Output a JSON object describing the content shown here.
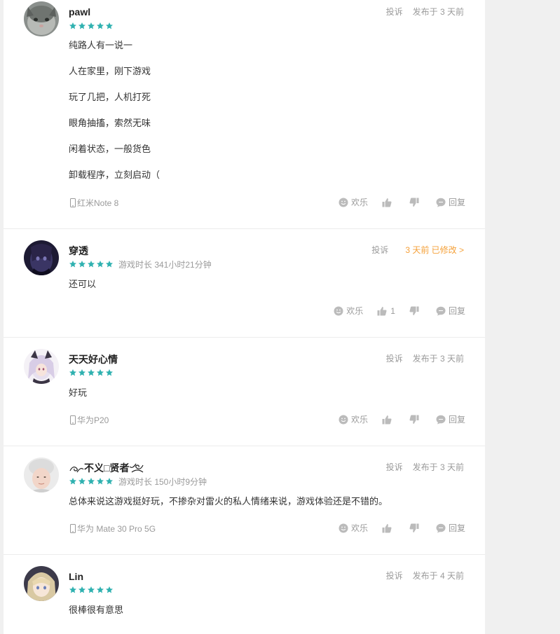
{
  "report_label": "投诉",
  "actions": {
    "fun_label": "欢乐",
    "reply_label": "回复"
  },
  "colors": {
    "star": "#2fb1b0",
    "edited_date": "#f5a13a",
    "muted": "#9a9a9a"
  },
  "reviews": [
    {
      "name": "pawl",
      "rating": 5,
      "playtime": "",
      "date": "发布于 3 天前",
      "content": [
        "纯路人有一说一",
        "人在家里，刚下游戏",
        "玩了几把，人机打死",
        "眼角抽搐，索然无味",
        "闲着状态，一般货色",
        "卸载程序，立刻启动（"
      ],
      "device": "红米Note 8",
      "likes": ""
    },
    {
      "name": "穿透",
      "rating": 5,
      "playtime": "游戏时长 341小时21分钟",
      "date": "3 天前 已修改 >",
      "content": [
        "还可以"
      ],
      "device": "",
      "likes": "1"
    },
    {
      "name": "天天好心情",
      "rating": 5,
      "playtime": "",
      "date": "发布于 3 天前",
      "content": [
        "好玩"
      ],
      "device": "华为P20",
      "likes": ""
    },
    {
      "name": "不义□贤者",
      "rating": 5,
      "playtime": "游戏时长 150小时9分钟",
      "date": "发布于 3 天前",
      "content": [
        "总体来说这游戏挺好玩，不掺杂对雷火的私人情绪来说，游戏体验还是不错的。"
      ],
      "device": "华为 Mate 30 Pro 5G",
      "likes": ""
    },
    {
      "name": "Lin",
      "rating": 5,
      "playtime": "",
      "date": "发布于 4 天前",
      "content": [
        "很棒很有意思"
      ],
      "device": "",
      "likes": ""
    }
  ]
}
